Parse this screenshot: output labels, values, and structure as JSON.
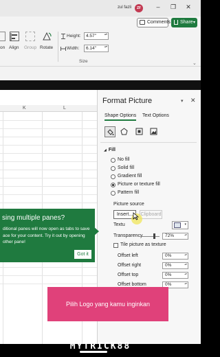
{
  "window": {
    "user_name": "zul fazli",
    "avatar_initials": "ZF",
    "minimize_glyph": "–",
    "restore_glyph": "❐",
    "close_glyph": "✕"
  },
  "ribbon": {
    "comments_label": "Comments",
    "share_label": "Share",
    "share_chevron": "▾",
    "partial_label": "on",
    "align_label": "Align",
    "group_label": "Group",
    "rotate_label": "Rotate",
    "height_label": "Height:",
    "height_value": "4.57\"",
    "width_label": "Width:",
    "width_value": "6.14\"",
    "size_group_label": "Size",
    "spin_glyph": "▴▾",
    "expand_glyph": "⌄"
  },
  "sheet": {
    "columns": [
      "K",
      "L"
    ]
  },
  "pane": {
    "title": "Format Picture",
    "chevron": "▾",
    "close": "✕",
    "tabs": [
      "Shape Options",
      "Text Options"
    ],
    "fill_section": "Fill",
    "fill_arrow": "◢",
    "fill_options": [
      "No fill",
      "Solid fill",
      "Gradient fill",
      "Picture or texture fill",
      "Pattern fill"
    ],
    "selected_fill": "Picture or texture fill",
    "picture_source_label": "Picture source",
    "insert_label": "Insert...",
    "clipboard_label": "Clipboard",
    "texture_label": "Textu",
    "transparency_label": "Transparency",
    "transparency_value": "72%",
    "transparency_level": 0.72,
    "tile_label": "Tile picture as texture",
    "offsets": [
      {
        "label": "Offset left",
        "value": "0%"
      },
      {
        "label": "Offset right",
        "value": "0%"
      },
      {
        "label": "Offset top",
        "value": "0%"
      },
      {
        "label": "Offset bottom",
        "value": "0%"
      }
    ]
  },
  "popup": {
    "title": "sing multiple panes?",
    "body": "ditional panes will now open as tabs to save ace for your content. Try it out by opening other pane!",
    "button_label": "Got it"
  },
  "overlay": {
    "caption": "Pilih Logo yang kamu inginkan",
    "brand": "MYTRICK88"
  },
  "colors": {
    "accent_green": "#1f7a3f",
    "banner_pink": "#e0417a",
    "avatar_red": "#c23a52"
  }
}
